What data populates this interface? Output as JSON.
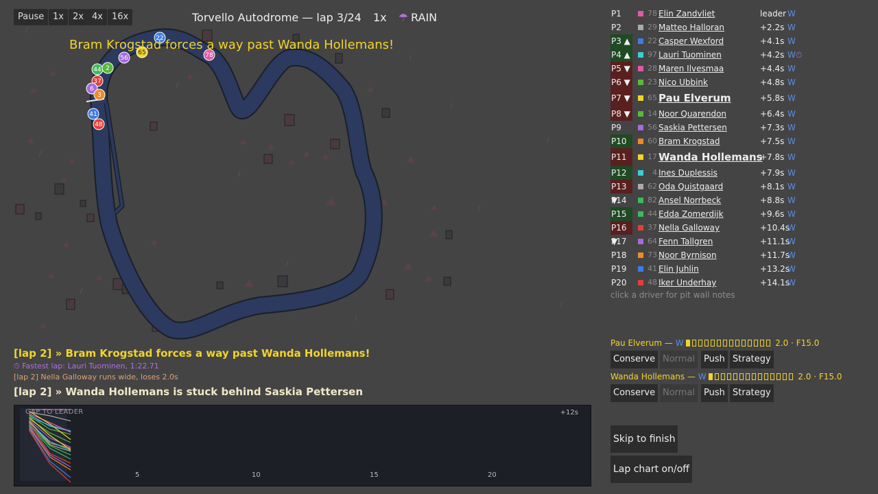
{
  "topbar": {
    "pause": "Pause",
    "speeds": [
      "1x",
      "2x",
      "4x",
      "16x"
    ]
  },
  "race": {
    "track": "Torvello Autodrome — lap 3/24",
    "speed": "1x",
    "weather_icon": "umbrella-icon",
    "weather_glyph": "☂",
    "weather": "RAIN"
  },
  "banner": "Bram Krogstad forces a way past Wanda Hollemans!",
  "cars_on_track": [
    "22",
    "78",
    "65",
    "56",
    "44",
    "2",
    "37",
    "6",
    "3",
    "41",
    "48"
  ],
  "standings": [
    {
      "pos": "P1",
      "trend": "",
      "number": "78",
      "color": "#e05aa8",
      "name": "Elin Zandvliet",
      "gap": "leader",
      "tyre": "W"
    },
    {
      "pos": "P2",
      "trend": "",
      "number": "29",
      "color": "#aaaaaa",
      "name": "Matteo Halloran",
      "gap": "+2.2s",
      "tyre": "W"
    },
    {
      "pos": "P3",
      "trend": "▲",
      "number": "22",
      "color": "#3f7be6",
      "name": "Casper Wexford",
      "gap": "+4.1s",
      "tyre": "W"
    },
    {
      "pos": "P4",
      "trend": "▲",
      "number": "97",
      "color": "#3ccfcf",
      "name": "Lauri Tuominen",
      "gap": "+4.2s",
      "tyre": "W",
      "fastest_icon": "⏱"
    },
    {
      "pos": "P5",
      "trend": "▼",
      "number": "28",
      "color": "#e05aa8",
      "name": "Maren Ilvesmaa",
      "gap": "+4.4s",
      "tyre": "W"
    },
    {
      "pos": "P6",
      "trend": "▼",
      "number": "23",
      "color": "#5ab83a",
      "name": "Nico Ubbink",
      "gap": "+4.8s",
      "tyre": "W"
    },
    {
      "pos": "P7",
      "trend": "▼",
      "number": "65",
      "color": "#f2d42a",
      "name": "Pau Elverum",
      "gap": "+5.8s",
      "tyre": "W",
      "controlled": true
    },
    {
      "pos": "P8",
      "trend": "▼",
      "number": "14",
      "color": "#5ab83a",
      "name": "Noor Quarendon",
      "gap": "+6.4s",
      "tyre": "W"
    },
    {
      "pos": "P9",
      "trend": "",
      "number": "56",
      "color": "#a66ae0",
      "name": "Saskia Pettersen",
      "gap": "+7.3s",
      "tyre": "W"
    },
    {
      "pos": "P10",
      "trend": "▲",
      "number": "60",
      "color": "#ef8a2a",
      "name": "Bram Krogstad",
      "gap": "+7.5s",
      "tyre": "W"
    },
    {
      "pos": "P11",
      "trend": "▼",
      "number": "17",
      "color": "#f2d42a",
      "name": "Wanda Hollemans",
      "gap": "+7.8s",
      "tyre": "W",
      "controlled": true
    },
    {
      "pos": "P12",
      "trend": "▲",
      "number": "4",
      "color": "#3ccfcf",
      "name": "Ines Duplessis",
      "gap": "+7.9s",
      "tyre": "W"
    },
    {
      "pos": "P13",
      "trend": "▼",
      "number": "62",
      "color": "#aaaaaa",
      "name": "Oda Quistgaard",
      "gap": "+8.1s",
      "tyre": "W"
    },
    {
      "pos": "P14",
      "trend": "",
      "number": "82",
      "color": "#3dba5a",
      "name": "Ansel Norrbeck",
      "gap": "+8.8s",
      "tyre": "W"
    },
    {
      "pos": "P15",
      "trend": "▲",
      "number": "44",
      "color": "#3dba5a",
      "name": "Edda Zomerdijk",
      "gap": "+9.6s",
      "tyre": "W"
    },
    {
      "pos": "P16",
      "trend": "▼",
      "number": "37",
      "color": "#e0403a",
      "name": "Nella Galloway",
      "gap": "+10.4s",
      "tyre": "W"
    },
    {
      "pos": "P17",
      "trend": "",
      "number": "64",
      "color": "#a66ae0",
      "name": "Fenn Tallgren",
      "gap": "+11.1s",
      "tyre": "W"
    },
    {
      "pos": "P18",
      "trend": "",
      "number": "73",
      "color": "#ef8a2a",
      "name": "Noor Byrnison",
      "gap": "+11.7s",
      "tyre": "W"
    },
    {
      "pos": "P19",
      "trend": "",
      "number": "41",
      "color": "#3f7be6",
      "name": "Elin Juhlin",
      "gap": "+13.2s",
      "tyre": "W"
    },
    {
      "pos": "P20",
      "trend": "",
      "number": "48",
      "color": "#e0403a",
      "name": "Iker Underhay",
      "gap": "+14.1s",
      "tyre": "W"
    }
  ],
  "standings_hint": "click a driver for pit wall notes",
  "controls": [
    {
      "driver": "Pau Elverum — ",
      "tyre": "W",
      "stats": "2.0 · F15.0",
      "fill": 0.1,
      "buttons": [
        "Conserve",
        "Normal",
        "Push",
        "Strategy"
      ],
      "active": "Normal"
    },
    {
      "driver": "Wanda Hollemans — ",
      "tyre": "W",
      "stats": "2.0 · F15.0",
      "fill": 0.1,
      "buttons": [
        "Conserve",
        "Normal",
        "Push",
        "Strategy"
      ],
      "active": "Normal"
    }
  ],
  "actions": {
    "skip": "Skip to finish",
    "lapchart": "Lap chart on/off"
  },
  "log": [
    {
      "text": "[lap 2] » Bram Krogstad forces a way past Wanda Hollemans!",
      "style": "big",
      "color": "#f2d42a"
    },
    {
      "text": "⏱ Fastest lap: Lauri Tuominen, 1:22.71",
      "style": "small",
      "color": "#b070e0"
    },
    {
      "text": "[lap 2] Nella Galloway runs wide, loses 2.0s",
      "style": "small",
      "color": "#e0a07a"
    },
    {
      "text": "[lap 2] » Wanda Hollemans is stuck behind Saskia Pettersen",
      "style": "big",
      "color": "#f1e8c8"
    }
  ],
  "chart_data": {
    "type": "line",
    "title": "GAP TO LEADER",
    "ymax_label": "+12s",
    "xticks": [
      "5",
      "10",
      "15",
      "20"
    ],
    "x": [
      1,
      2,
      3
    ],
    "series": [
      {
        "color": "#e05aa8",
        "values": [
          0,
          0,
          0
        ]
      },
      {
        "color": "#aaaaaa",
        "values": [
          0.5,
          1.2,
          2.2
        ]
      },
      {
        "color": "#3f7be6",
        "values": [
          1.5,
          3,
          4.1
        ]
      },
      {
        "color": "#3ccfcf",
        "values": [
          1,
          3.2,
          4.2
        ]
      },
      {
        "color": "#e05aa8",
        "values": [
          0.8,
          2.5,
          4.4
        ]
      },
      {
        "color": "#5ab83a",
        "values": [
          1.2,
          3.8,
          4.8
        ]
      },
      {
        "color": "#f2d42a",
        "values": [
          0.3,
          2.8,
          5.8
        ]
      },
      {
        "color": "#5ab83a",
        "values": [
          1.8,
          4.5,
          6.4
        ]
      },
      {
        "color": "#a66ae0",
        "values": [
          2,
          5.5,
          7.3
        ]
      },
      {
        "color": "#ef8a2a",
        "values": [
          2.2,
          6.5,
          7.5
        ]
      },
      {
        "color": "#f2d42a",
        "values": [
          1.5,
          5,
          7.8
        ]
      },
      {
        "color": "#3ccfcf",
        "values": [
          2.5,
          6.2,
          7.9
        ]
      },
      {
        "color": "#aaaaaa",
        "values": [
          2.3,
          6.8,
          8.1
        ]
      },
      {
        "color": "#3dba5a",
        "values": [
          2.8,
          7,
          8.8
        ]
      },
      {
        "color": "#3dba5a",
        "values": [
          3,
          7.5,
          9.6
        ]
      },
      {
        "color": "#e0403a",
        "values": [
          2.6,
          8.5,
          10.4
        ]
      },
      {
        "color": "#a66ae0",
        "values": [
          3.2,
          8.8,
          11.1
        ]
      },
      {
        "color": "#ef8a2a",
        "values": [
          3.5,
          9.2,
          11.7
        ]
      },
      {
        "color": "#3f7be6",
        "values": [
          3.8,
          10,
          13.2
        ]
      },
      {
        "color": "#e0403a",
        "values": [
          4,
          10.5,
          14.1
        ]
      }
    ],
    "xlim": [
      0.5,
      24
    ],
    "ylim": [
      0,
      12.5
    ]
  }
}
